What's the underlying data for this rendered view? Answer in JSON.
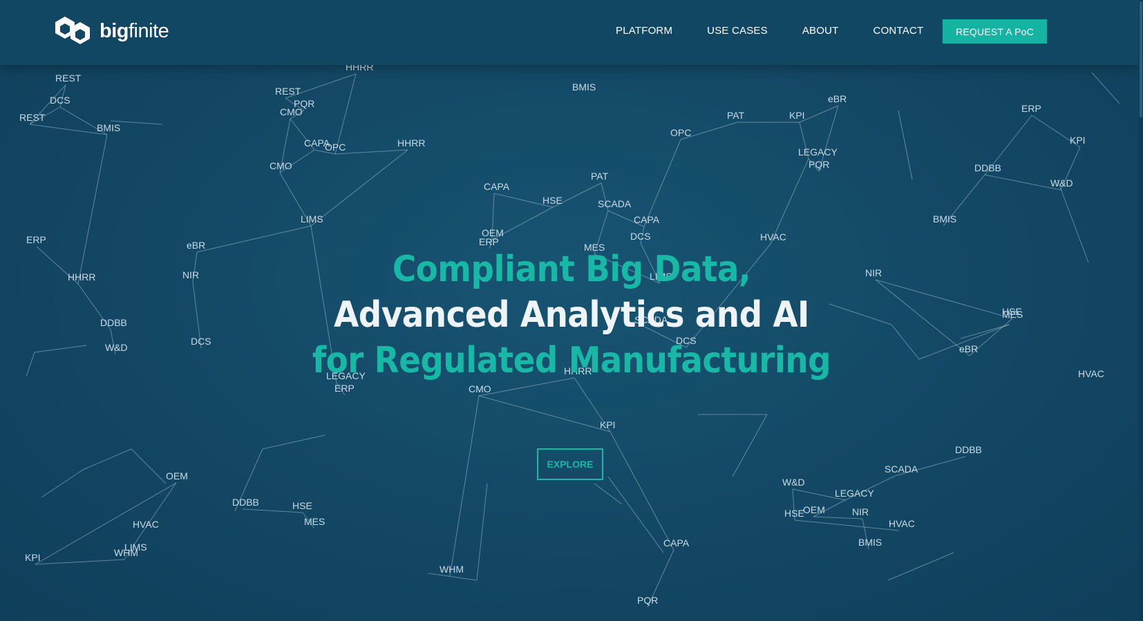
{
  "brand": {
    "name_bold": "big",
    "name_regular": "finite",
    "accent": "#14b3a2",
    "background": "#154a67"
  },
  "nav": {
    "items": [
      "PLATFORM",
      "USE CASES",
      "ABOUT",
      "CONTACT"
    ],
    "cta": "REQUEST A PoC"
  },
  "hero": {
    "line1": "Compliant Big Data,",
    "line2": "Advanced Analytics and AI",
    "line3": "for Regulated Manufacturing",
    "button": "EXPLORE"
  },
  "network_labels": [
    "REST",
    "DCS",
    "REST",
    "BMIS",
    "HHRR",
    "REST",
    "PQR",
    "CMO",
    "CAPA",
    "OPC",
    "HHRR",
    "CMO",
    "LIMS",
    "BMIS",
    "PAT",
    "KPI",
    "eBR",
    "OPC",
    "LEGACY",
    "PQR",
    "ERP",
    "KPI",
    "DDBB",
    "W&D",
    "BMIS",
    "CAPA",
    "HSE",
    "PAT",
    "SCADA",
    "CAPA",
    "DCS",
    "OEM",
    "ERP",
    "MES",
    "LIMS",
    "ERP",
    "eBR",
    "HHRR",
    "NIR",
    "DDBB",
    "W&D",
    "DCS",
    "HVAC",
    "NIR",
    "HSE",
    "MES",
    "eBR",
    "HVAC",
    "DCS",
    "LEGACY",
    "ERP",
    "CMO",
    "KPI",
    "OEM",
    "DDBB",
    "HSE",
    "MES",
    "HVAC",
    "LIMS",
    "WHM",
    "KPI",
    "WHM",
    "CAPA",
    "PQR",
    "W&D",
    "LEGACY",
    "OEM",
    "NIR",
    "HSE",
    "HVAC",
    "BMIS",
    "SCADA",
    "DDBB",
    "HHRR",
    "SCADA"
  ]
}
